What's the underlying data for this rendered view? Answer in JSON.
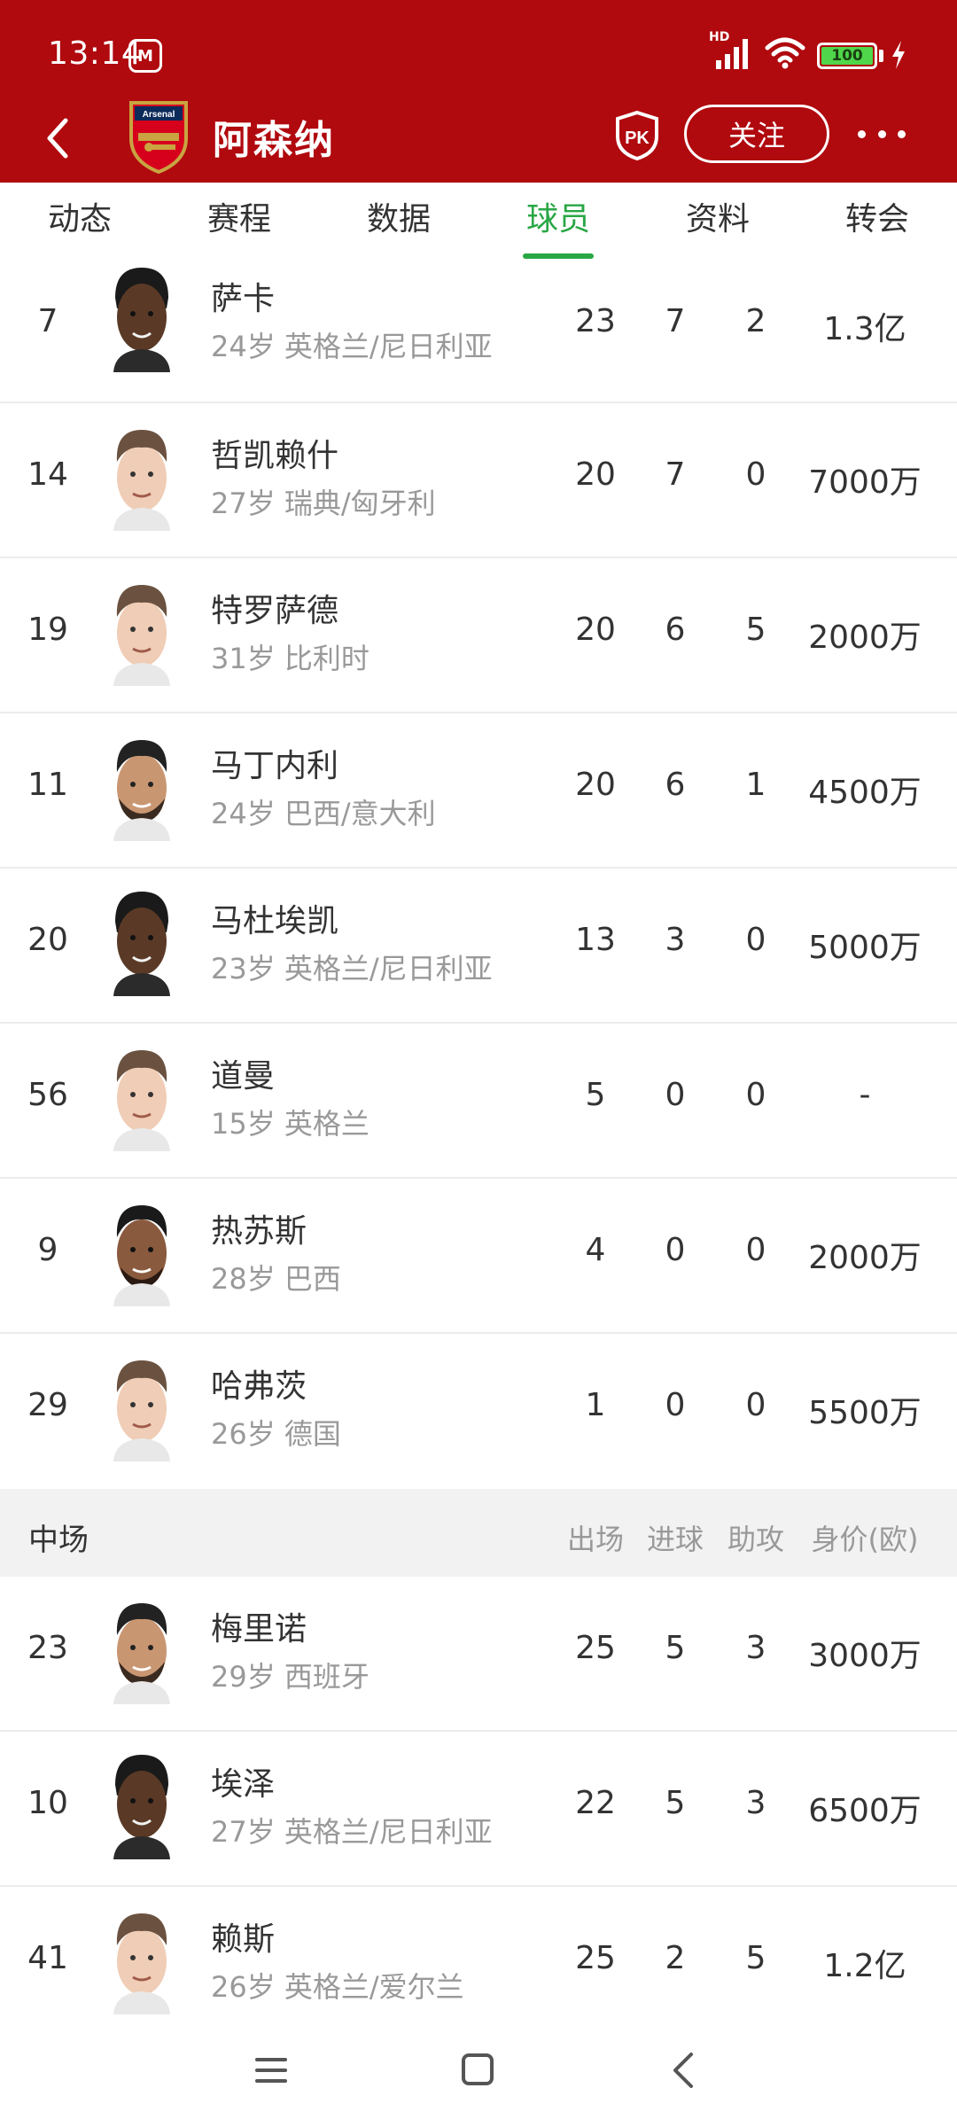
{
  "status_bar": {
    "time": "13:14",
    "network_label": "HD",
    "battery": "100"
  },
  "header": {
    "team_name": "阿森纳",
    "crest_label": "Arsenal",
    "pk_label": "PK",
    "follow_label": "关注"
  },
  "tabs": [
    {
      "label": "动态",
      "active": false
    },
    {
      "label": "赛程",
      "active": false
    },
    {
      "label": "数据",
      "active": false
    },
    {
      "label": "球员",
      "active": true
    },
    {
      "label": "资料",
      "active": false
    },
    {
      "label": "转会",
      "active": false
    }
  ],
  "forwards": [
    {
      "number": "7",
      "name": "萨卡",
      "meta": "24岁 英格兰/尼日利亚",
      "apps": "23",
      "goals": "7",
      "assists": "2",
      "value": "1.3亿"
    },
    {
      "number": "14",
      "name": "哲凯赖什",
      "meta": "27岁 瑞典/匈牙利",
      "apps": "20",
      "goals": "7",
      "assists": "0",
      "value": "7000万"
    },
    {
      "number": "19",
      "name": "特罗萨德",
      "meta": "31岁 比利时",
      "apps": "20",
      "goals": "6",
      "assists": "5",
      "value": "2000万"
    },
    {
      "number": "11",
      "name": "马丁内利",
      "meta": "24岁 巴西/意大利",
      "apps": "20",
      "goals": "6",
      "assists": "1",
      "value": "4500万"
    },
    {
      "number": "20",
      "name": "马杜埃凯",
      "meta": "23岁 英格兰/尼日利亚",
      "apps": "13",
      "goals": "3",
      "assists": "0",
      "value": "5000万"
    },
    {
      "number": "56",
      "name": "道曼",
      "meta": "15岁 英格兰",
      "apps": "5",
      "goals": "0",
      "assists": "0",
      "value": "-"
    },
    {
      "number": "9",
      "name": "热苏斯",
      "meta": "28岁 巴西",
      "apps": "4",
      "goals": "0",
      "assists": "0",
      "value": "2000万"
    },
    {
      "number": "29",
      "name": "哈弗茨",
      "meta": "26岁 德国",
      "apps": "1",
      "goals": "0",
      "assists": "0",
      "value": "5500万"
    }
  ],
  "midfield_section": {
    "title": "中场",
    "col_apps": "出场",
    "col_goals": "进球",
    "col_assists": "助攻",
    "col_value": "身价(欧)"
  },
  "midfielders": [
    {
      "number": "23",
      "name": "梅里诺",
      "meta": "29岁 西班牙",
      "apps": "25",
      "goals": "5",
      "assists": "3",
      "value": "3000万"
    },
    {
      "number": "10",
      "name": "埃泽",
      "meta": "27岁 英格兰/尼日利亚",
      "apps": "22",
      "goals": "5",
      "assists": "3",
      "value": "6500万"
    },
    {
      "number": "41",
      "name": "赖斯",
      "meta": "26岁 英格兰/爱尔兰",
      "apps": "25",
      "goals": "2",
      "assists": "5",
      "value": "1.2亿"
    }
  ],
  "colors": {
    "header_bg": "#b0090e",
    "accent_green": "#28a745",
    "section_bg": "#f2f2f2",
    "muted_text": "#999999"
  }
}
